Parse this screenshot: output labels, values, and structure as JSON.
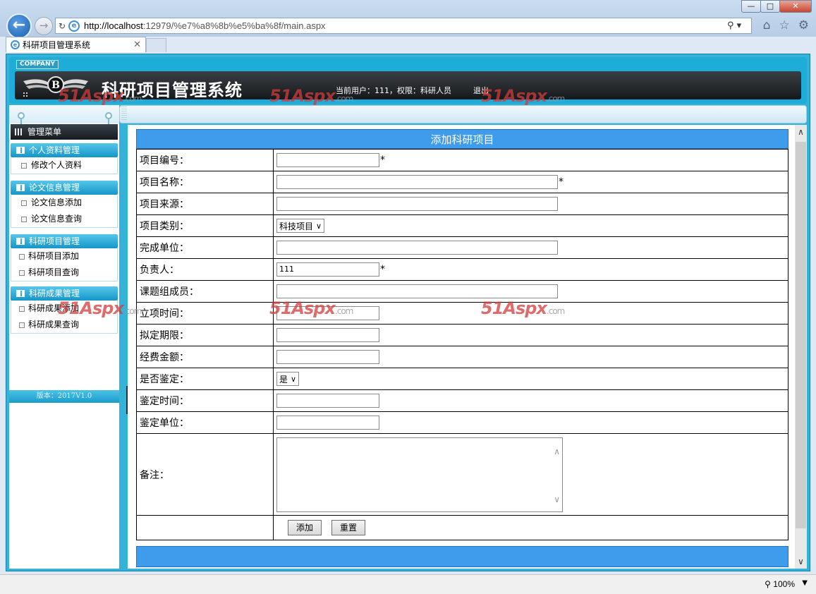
{
  "browser": {
    "url_host": "http://localhost",
    "url_rest": ":12979/%e7%a8%8b%e5%ba%8f/main.aspx",
    "tab_title": "科研项目管理系统",
    "zoom": "100%"
  },
  "header": {
    "company": "COMPANY",
    "title": "科研项目管理系统",
    "user_info": "当前用户：111，权限：科研人员",
    "logout": "退出"
  },
  "sidebar": {
    "menu_title": "管理菜单",
    "groups": [
      {
        "title": "个人资料管理",
        "items": [
          "修改个人资料"
        ]
      },
      {
        "title": "论文信息管理",
        "items": [
          "论文信息添加",
          "论文信息查询"
        ]
      },
      {
        "title": "科研项目管理",
        "items": [
          "科研项目添加",
          "科研项目查询"
        ]
      },
      {
        "title": "科研成果管理",
        "items": [
          "科研成果添加",
          "科研成果查询"
        ]
      }
    ],
    "version": "版本：2017V1.0"
  },
  "form": {
    "title": "添加科研项目",
    "fields": {
      "project_no": {
        "label": "项目编号：",
        "value": "",
        "required": "*"
      },
      "project_name": {
        "label": "项目名称：",
        "value": "",
        "required": "*"
      },
      "project_source": {
        "label": "项目来源：",
        "value": ""
      },
      "project_type": {
        "label": "项目类别：",
        "value": "科技项目"
      },
      "completion_unit": {
        "label": "完成单位：",
        "value": ""
      },
      "leader": {
        "label": "负责人：",
        "value": "111",
        "required": "*"
      },
      "members": {
        "label": "课题组成员：",
        "value": ""
      },
      "start_time": {
        "label": "立项时间：",
        "value": ""
      },
      "deadline": {
        "label": "拟定期限：",
        "value": ""
      },
      "funding": {
        "label": "经费金额：",
        "value": ""
      },
      "appraised": {
        "label": "是否鉴定：",
        "value": "是"
      },
      "appraisal_time": {
        "label": "鉴定时间：",
        "value": ""
      },
      "appraisal_unit": {
        "label": "鉴定单位：",
        "value": ""
      },
      "remarks": {
        "label": "备注：",
        "value": ""
      }
    },
    "buttons": {
      "add": "添加",
      "reset": "重置"
    }
  },
  "watermark": {
    "text": "51Aspx",
    "suffix": ".com"
  },
  "colors": {
    "accent": "#3f9cec",
    "frame": "#35b2d8",
    "banner": "#1e2226"
  }
}
